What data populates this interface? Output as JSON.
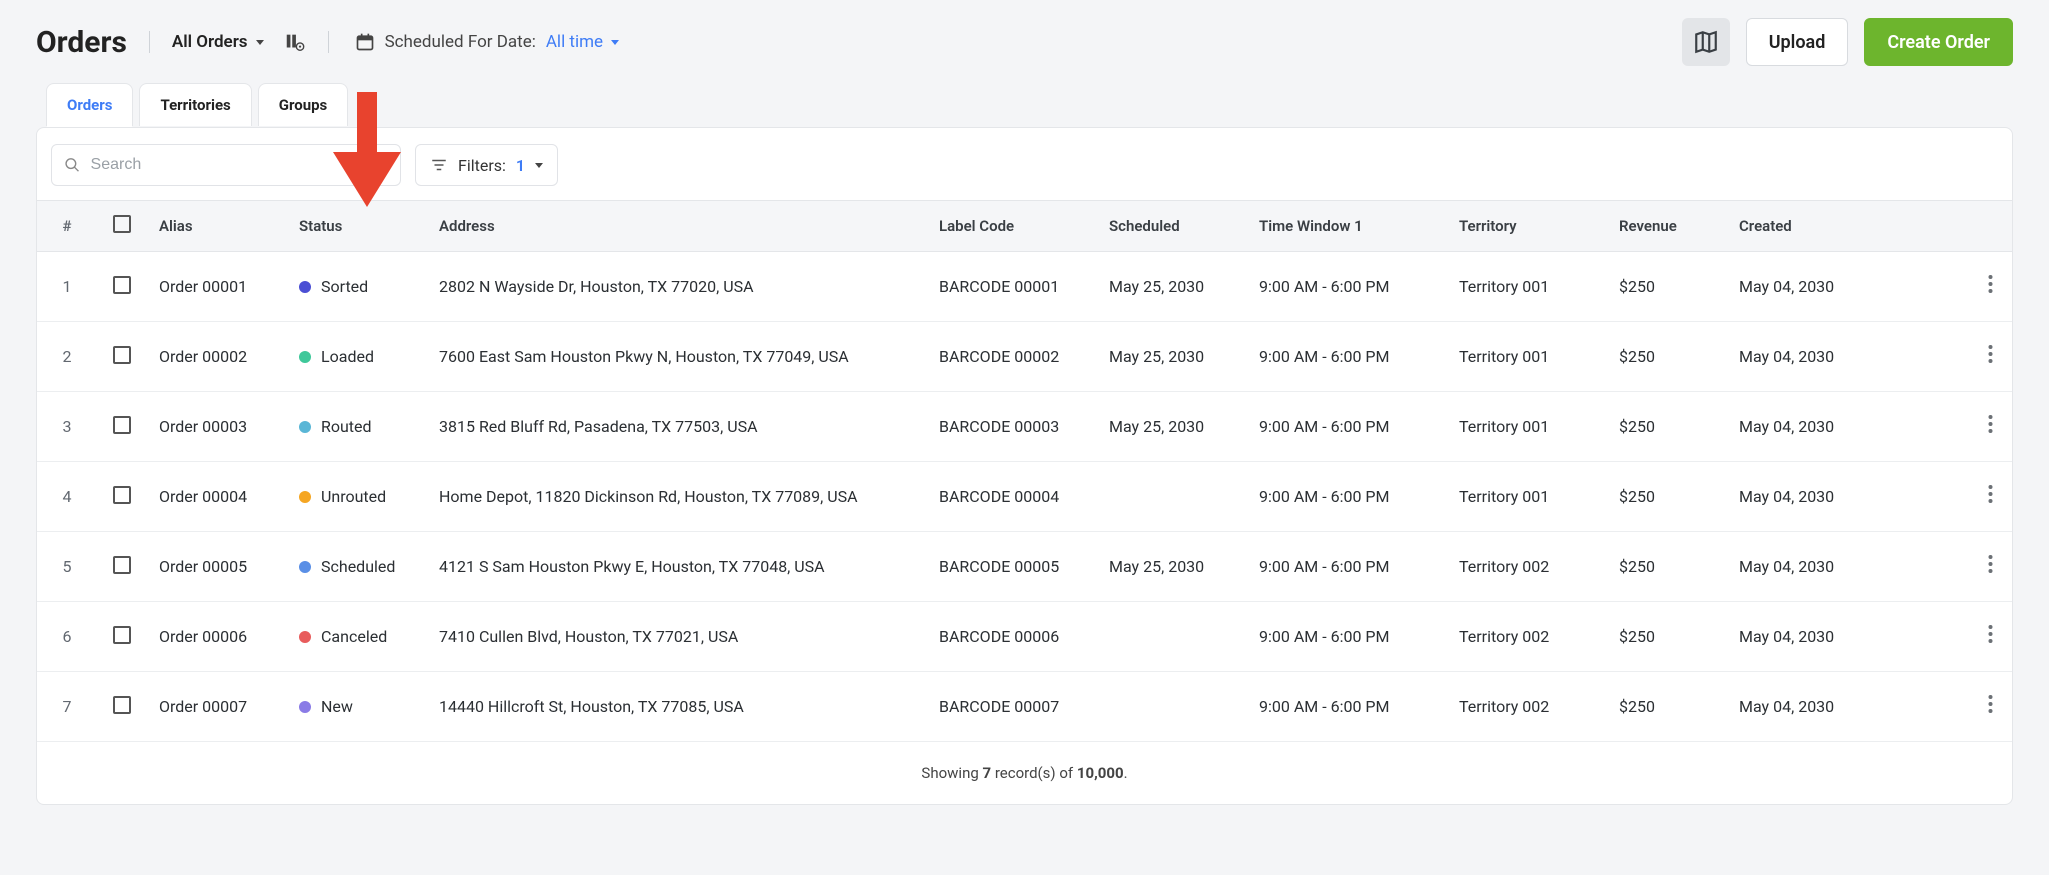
{
  "header": {
    "title": "Orders",
    "all_orders": "All Orders",
    "scheduled_label": "Scheduled For Date:",
    "scheduled_value": "All time",
    "upload": "Upload",
    "create": "Create Order"
  },
  "tabs": {
    "orders": "Orders",
    "territories": "Territories",
    "groups": "Groups"
  },
  "toolbar": {
    "search_placeholder": "Search",
    "filters_label": "Filters:",
    "filters_count": "1"
  },
  "columns": {
    "num": "#",
    "alias": "Alias",
    "status": "Status",
    "address": "Address",
    "label_code": "Label Code",
    "scheduled": "Scheduled",
    "time_window": "Time Window 1",
    "territory": "Territory",
    "revenue": "Revenue",
    "created": "Created"
  },
  "rows": [
    {
      "num": "1",
      "alias": "Order 00001",
      "status": "Sorted",
      "color": "#4b4fd4",
      "address": "2802 N Wayside Dr, Houston, TX 77020, USA",
      "label": "BARCODE 00001",
      "scheduled": "May 25, 2030",
      "tw": "9:00 AM - 6:00 PM",
      "territory": "Territory 001",
      "revenue": "$250",
      "created": "May 04, 2030"
    },
    {
      "num": "2",
      "alias": "Order 00002",
      "status": "Loaded",
      "color": "#3fc89a",
      "address": "7600 East Sam Houston Pkwy N, Houston, TX 77049, USA",
      "label": "BARCODE 00002",
      "scheduled": "May 25, 2030",
      "tw": "9:00 AM - 6:00 PM",
      "territory": "Territory 001",
      "revenue": "$250",
      "created": "May 04, 2030"
    },
    {
      "num": "3",
      "alias": "Order 00003",
      "status": "Routed",
      "color": "#5ab6d6",
      "address": "3815 Red Bluff Rd, Pasadena, TX 77503, USA",
      "label": "BARCODE 00003",
      "scheduled": "May 25, 2030",
      "tw": "9:00 AM - 6:00 PM",
      "territory": "Territory 001",
      "revenue": "$250",
      "created": "May 04, 2030"
    },
    {
      "num": "4",
      "alias": "Order 00004",
      "status": "Unrouted",
      "color": "#f5a623",
      "address": "Home Depot, 11820 Dickinson Rd, Houston, TX 77089, USA",
      "label": "BARCODE 00004",
      "scheduled": "",
      "tw": "9:00 AM - 6:00 PM",
      "territory": "Territory 001",
      "revenue": "$250",
      "created": "May 04, 2030"
    },
    {
      "num": "5",
      "alias": "Order 00005",
      "status": "Scheduled",
      "color": "#5a8fe6",
      "address": "4121 S Sam Houston Pkwy E, Houston, TX 77048, USA",
      "label": "BARCODE 00005",
      "scheduled": "May 25, 2030",
      "tw": "9:00 AM - 6:00 PM",
      "territory": "Territory 002",
      "revenue": "$250",
      "created": "May 04, 2030"
    },
    {
      "num": "6",
      "alias": "Order 00006",
      "status": "Canceled",
      "color": "#e85c5c",
      "address": "7410 Cullen Blvd, Houston, TX 77021, USA",
      "label": "BARCODE 00006",
      "scheduled": "",
      "tw": "9:00 AM - 6:00 PM",
      "territory": "Territory 002",
      "revenue": "$250",
      "created": "May 04, 2030"
    },
    {
      "num": "7",
      "alias": "Order 00007",
      "status": "New",
      "color": "#8a7be6",
      "address": "14440 Hillcroft St, Houston, TX 77085, USA",
      "label": "BARCODE 00007",
      "scheduled": "",
      "tw": "9:00 AM - 6:00 PM",
      "territory": "Territory 002",
      "revenue": "$250",
      "created": "May 04, 2030"
    }
  ],
  "footer": {
    "prefix": "Showing ",
    "count": "7",
    "mid": " record(s) of ",
    "total": "10,000",
    "suffix": "."
  }
}
